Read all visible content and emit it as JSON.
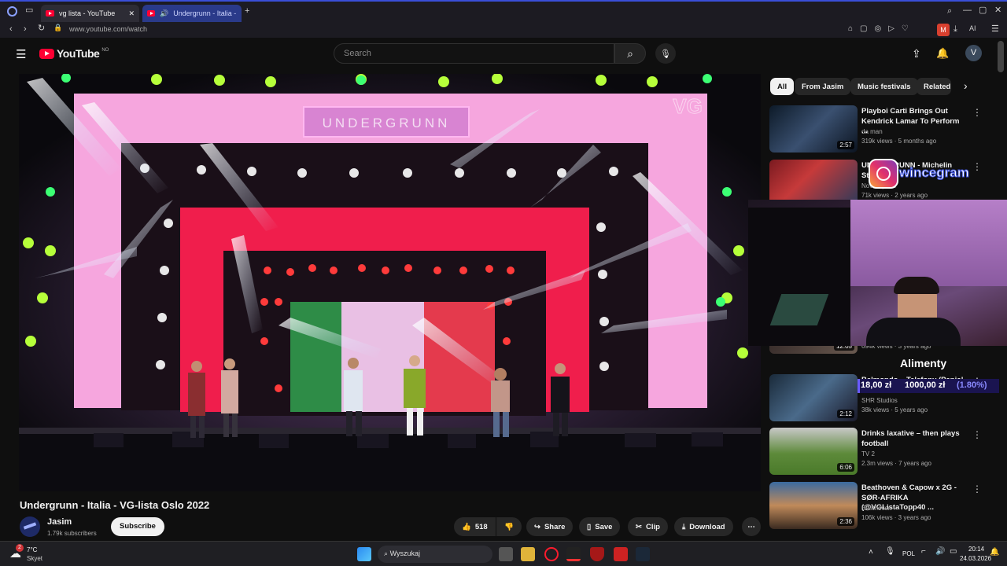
{
  "browser": {
    "tabs": [
      {
        "label": "vg lista - YouTube"
      },
      {
        "label": "Undergrunn - Italia - V"
      }
    ],
    "address": "www.youtube.com/watch"
  },
  "header": {
    "logo": "YouTube",
    "region": "NO",
    "search_placeholder": "Search",
    "avatar_letter": "V"
  },
  "video": {
    "title": "Undergrunn - Italia - VG-lista Oslo 2022",
    "stage_sign": "UNDERGRUNN",
    "watermark": "VG"
  },
  "channel": {
    "name": "Jasim",
    "subs": "1.79k subscribers",
    "subscribe": "Subscribe"
  },
  "actions": {
    "likes": "518",
    "share": "Share",
    "save": "Save",
    "clip": "Clip",
    "download": "Download"
  },
  "chips": [
    "All",
    "From Jasim",
    "Music festivals",
    "Related"
  ],
  "related": [
    {
      "title": "Playboi Carti Brings Out Kendrick Lamar To Perform ...",
      "channel": "da man",
      "meta": "319k views · 5 months ago",
      "duration": "2:57"
    },
    {
      "title": "UNDERGRUNN - Michelin Stjerne",
      "channel": "Nova Sports",
      "meta": "71k views · 2 years ago",
      "duration": ""
    },
    {
      "title": "",
      "channel": "",
      "meta": "694k views · 3 years ago",
      "duration": "12:05"
    },
    {
      "title": "Belmondo – Telefony (Panic!",
      "channel": "SHR Studios",
      "meta": "38k views · 5 years ago",
      "duration": "2:12"
    },
    {
      "title": "Drinks laxative – then plays football",
      "channel": "TV 2",
      "meta": "2.3m views · 7 years ago",
      "duration": "6:06"
    },
    {
      "title": "Beathoven & Capow x 2G - SØR-AFRIKA (@VGListaTopp40 ...",
      "channel": "Beathoven",
      "meta": "106k views · 3 years ago",
      "duration": "2:36"
    }
  ],
  "overlay": {
    "instagram": "wincegram",
    "label": "Alimenty",
    "amount_left": "18,00 zł",
    "amount_right": "1000,00 zł",
    "percent": "(1.80%)",
    "progress": 0.018
  },
  "taskbar": {
    "temp": "7°C",
    "weather": "Skyet",
    "search": "Wyszukaj",
    "lang": "POL",
    "time": "20:14",
    "date": "24.03.2026",
    "badge": "2"
  },
  "colors": {
    "accent": "#3ea6ff",
    "yt_red": "#ff0033",
    "instagram": "#e1306c"
  }
}
